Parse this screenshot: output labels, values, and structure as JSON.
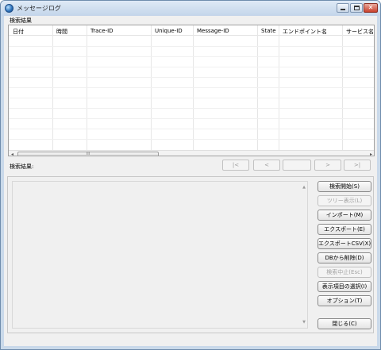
{
  "window": {
    "title": "メッセージログ"
  },
  "results": {
    "section_title": "検索結果",
    "columns": [
      "日付",
      "時間",
      "Trace-ID",
      "Unique-ID",
      "Message-ID",
      "State",
      "エンドポイント名",
      "サービス名"
    ],
    "rows": [],
    "scroll_thumb": "III"
  },
  "pager": {
    "label": "検索結果:",
    "first": "|<",
    "prev": "<",
    "page": "",
    "next": ">",
    "last": ">|"
  },
  "actions": {
    "search_start": "検索開始(S)",
    "tree_view": "ツリー表示(L)",
    "import": "インポート(M)",
    "export": "エクスポート(E)",
    "export_csv": "エクスポートCSV(X)",
    "delete_from_db": "DBから削除(D)",
    "search_stop": "検索中止(Esc)",
    "select_columns": "表示項目の選択(I)",
    "options": "オプション(T)",
    "close": "閉じる(C)"
  },
  "colors": {
    "titlebar": "#c3d5ea",
    "client_bg": "#f0f0f0",
    "close_button": "#c9402c"
  }
}
